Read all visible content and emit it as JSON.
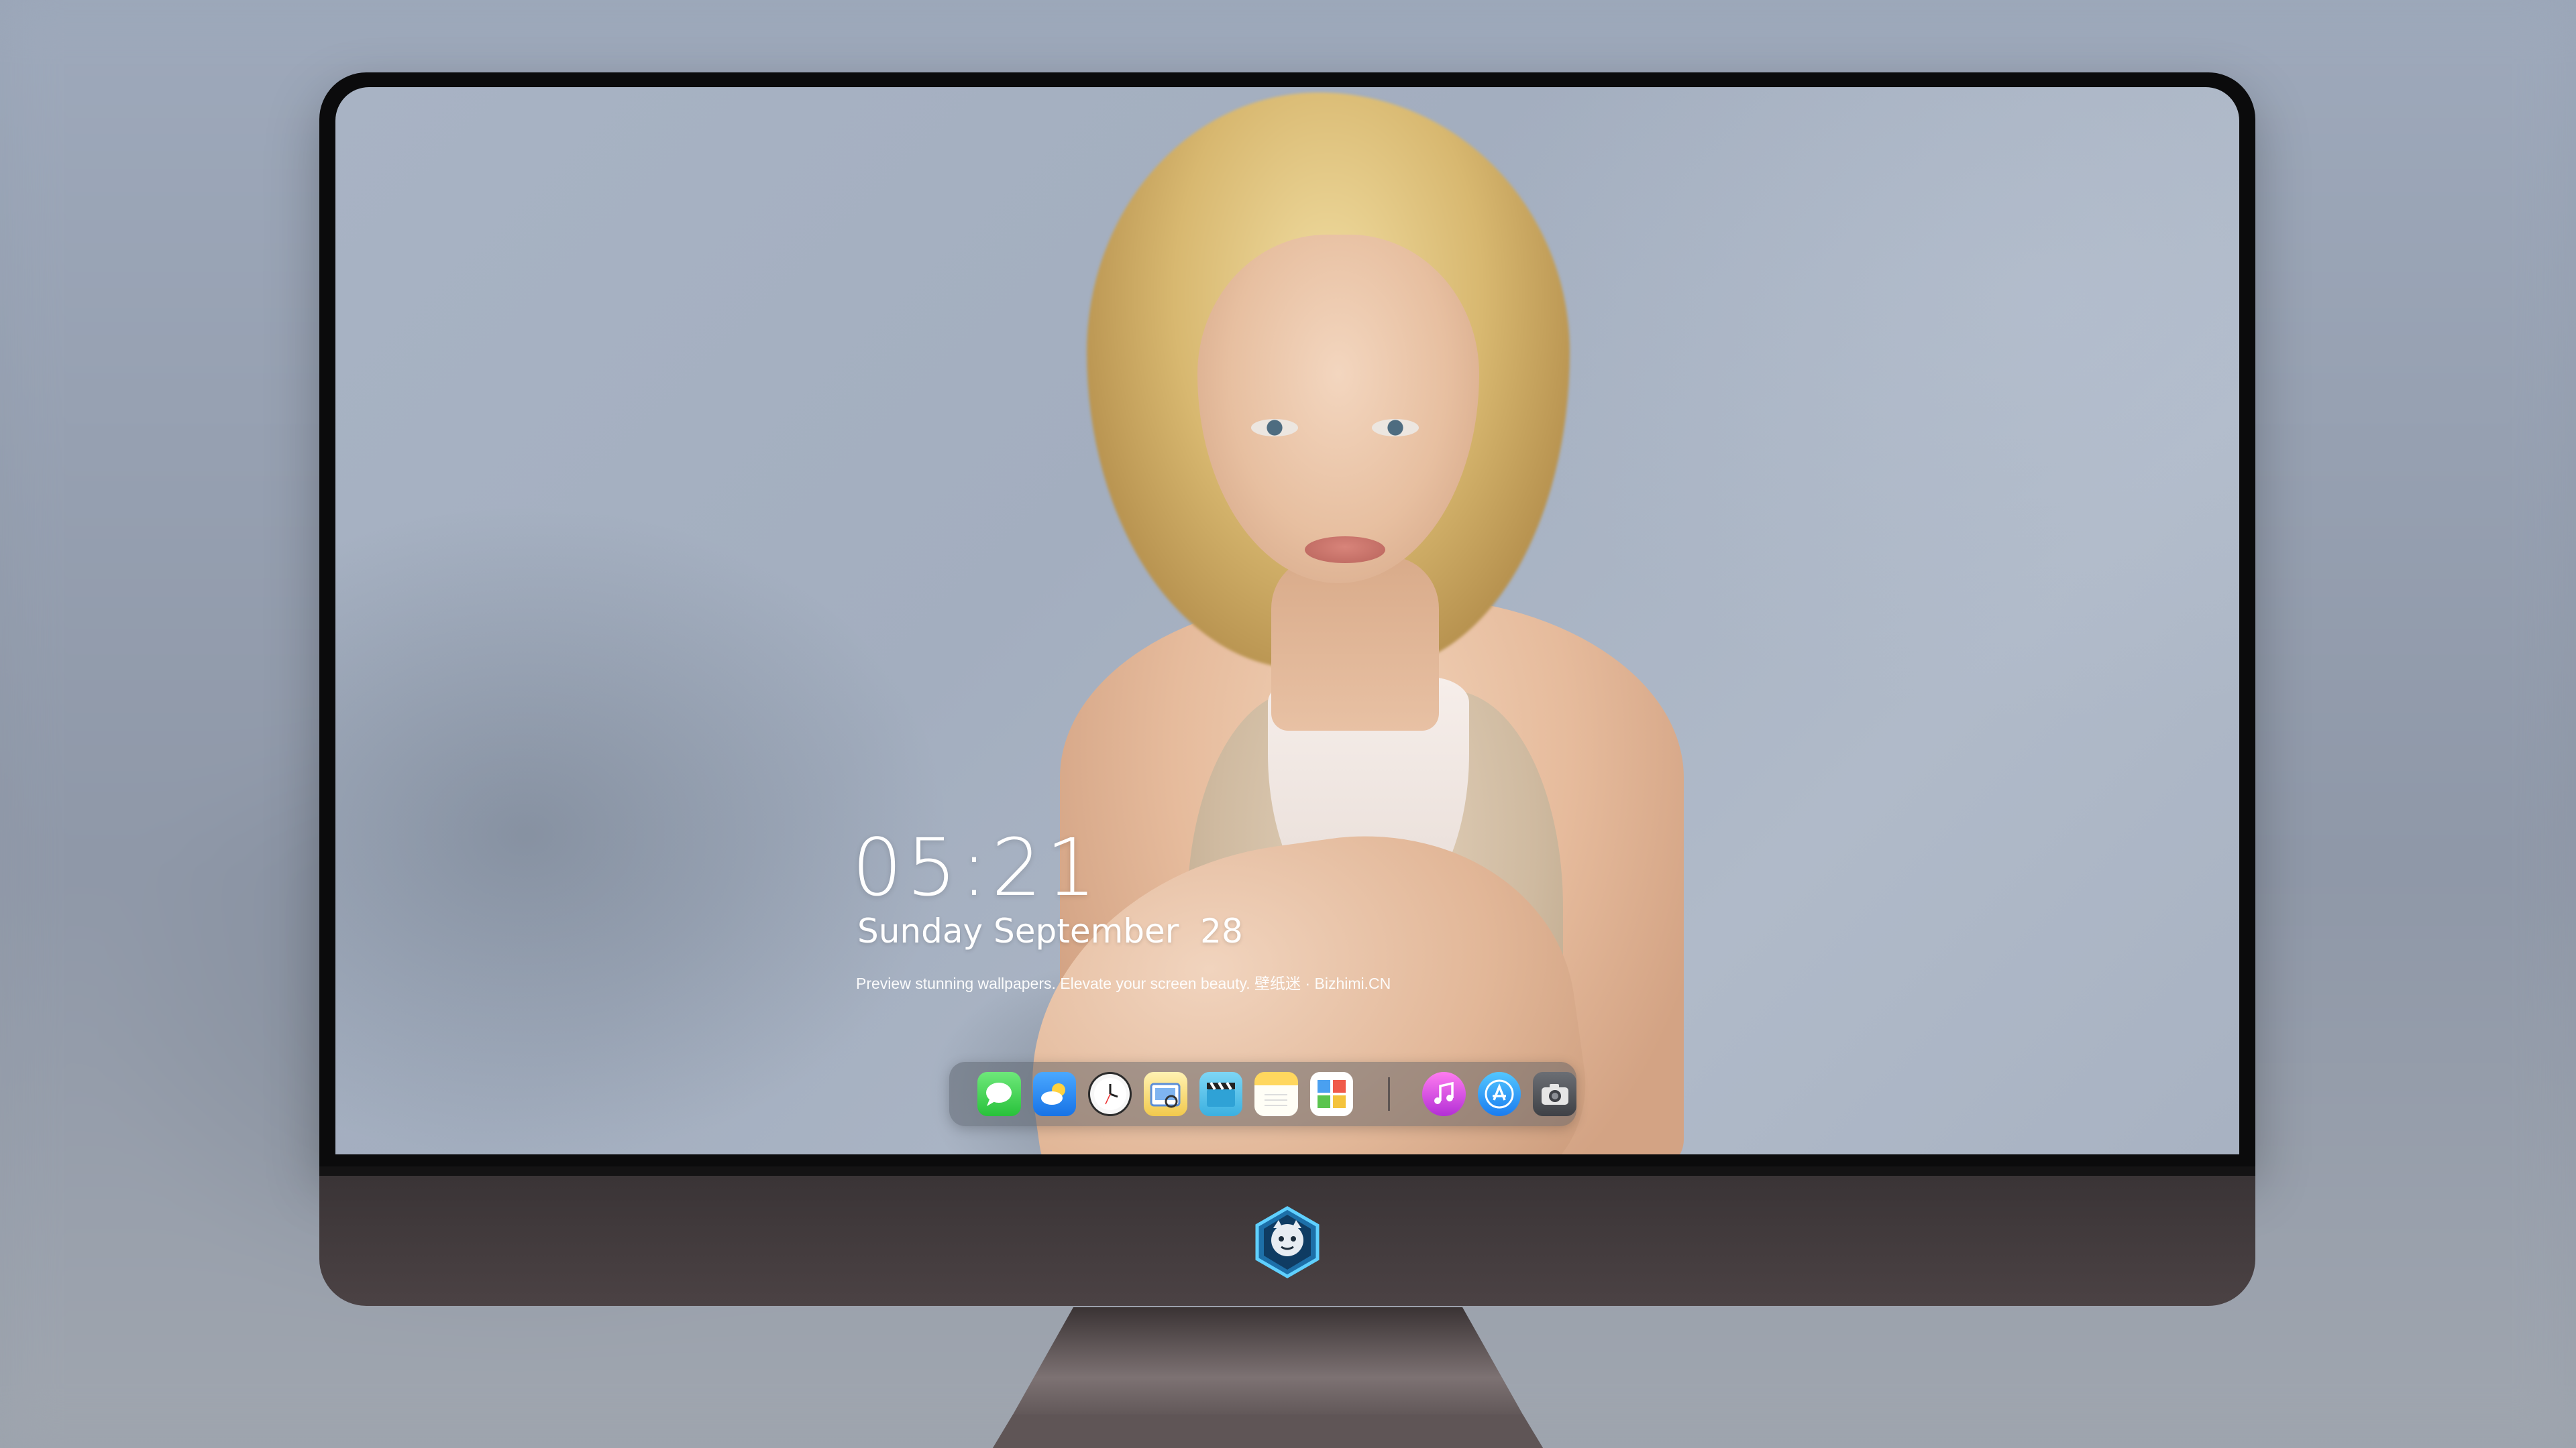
{
  "lock_screen": {
    "time": "05:21",
    "date": "Sunday September  28",
    "tagline": "Preview stunning wallpapers. Elevate your screen beauty. 壁纸迷 · Bizhimi.CN",
    "credit": ""
  },
  "dock": {
    "apps": [
      {
        "name": "Messages",
        "icon": "messages-icon"
      },
      {
        "name": "Weather",
        "icon": "weather-icon"
      },
      {
        "name": "Clock",
        "icon": "clock-icon"
      },
      {
        "name": "Preview",
        "icon": "preview-icon"
      },
      {
        "name": "Clips",
        "icon": "clips-icon"
      },
      {
        "name": "Notes",
        "icon": "notes-icon"
      },
      {
        "name": "Photos",
        "icon": "photos-icon"
      },
      {
        "name": "Music",
        "icon": "music-icon"
      },
      {
        "name": "App Store",
        "icon": "app-store-icon"
      },
      {
        "name": "Camera",
        "icon": "camera-icon"
      }
    ]
  },
  "colors": {
    "bezel": "#0b0b0c",
    "chin": "#3a3436",
    "text": "#ffffff",
    "dock_bg": "#50566073"
  }
}
